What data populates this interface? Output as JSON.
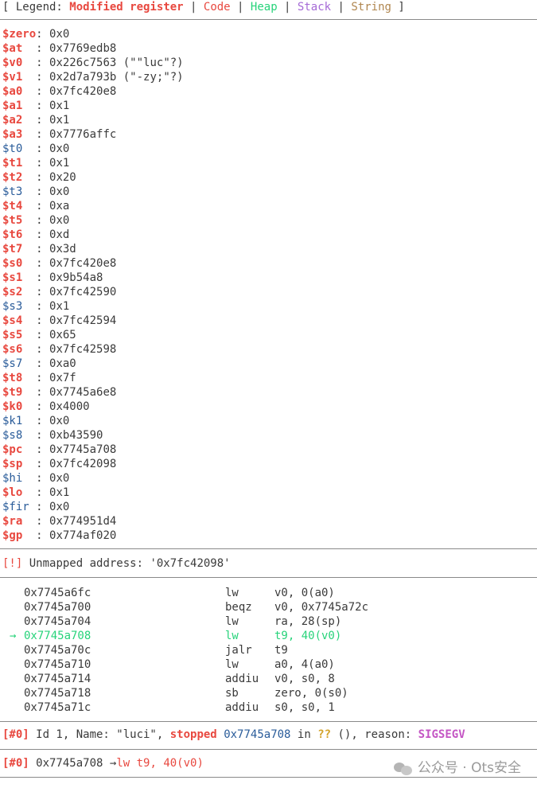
{
  "legend": {
    "prefix": "[ Legend: ",
    "modified": "Modified register",
    "code": "Code",
    "heap": "Heap",
    "stack": "Stack",
    "string": "String",
    "divider": " | ",
    "suffix": " ]"
  },
  "registers": [
    {
      "name": "$zero",
      "pad": "",
      "value": "0x0",
      "modified": true
    },
    {
      "name": "$at",
      "pad": "  ",
      "value": "0x7769edb8",
      "modified": true
    },
    {
      "name": "$v0",
      "pad": "  ",
      "value": "0x226c7563",
      "extra": "(\"\"luc\"?)",
      "modified": true
    },
    {
      "name": "$v1",
      "pad": "  ",
      "value": "0x2d7a793b",
      "extra": "(\"-zy;\"?)",
      "modified": true
    },
    {
      "name": "$a0",
      "pad": "  ",
      "value": "0x7fc420e8",
      "modified": true
    },
    {
      "name": "$a1",
      "pad": "  ",
      "value": "0x1",
      "modified": true
    },
    {
      "name": "$a2",
      "pad": "  ",
      "value": "0x1",
      "modified": true
    },
    {
      "name": "$a3",
      "pad": "  ",
      "value": "0x7776affc",
      "modified": true
    },
    {
      "name": "$t0",
      "pad": "  ",
      "value": "0x0",
      "modified": false
    },
    {
      "name": "$t1",
      "pad": "  ",
      "value": "0x1",
      "modified": true
    },
    {
      "name": "$t2",
      "pad": "  ",
      "value": "0x20",
      "modified": true
    },
    {
      "name": "$t3",
      "pad": "  ",
      "value": "0x0",
      "modified": false
    },
    {
      "name": "$t4",
      "pad": "  ",
      "value": "0xa",
      "modified": true
    },
    {
      "name": "$t5",
      "pad": "  ",
      "value": "0x0",
      "modified": true
    },
    {
      "name": "$t6",
      "pad": "  ",
      "value": "0xd",
      "modified": true
    },
    {
      "name": "$t7",
      "pad": "  ",
      "value": "0x3d",
      "modified": true
    },
    {
      "name": "$s0",
      "pad": "  ",
      "value": "0x7fc420e8",
      "modified": true
    },
    {
      "name": "$s1",
      "pad": "  ",
      "value": "0x9b54a8",
      "modified": true
    },
    {
      "name": "$s2",
      "pad": "  ",
      "value": "0x7fc42590",
      "modified": true
    },
    {
      "name": "$s3",
      "pad": "  ",
      "value": "0x1",
      "modified": false
    },
    {
      "name": "$s4",
      "pad": "  ",
      "value": "0x7fc42594",
      "modified": true
    },
    {
      "name": "$s5",
      "pad": "  ",
      "value": "0x65",
      "modified": true
    },
    {
      "name": "$s6",
      "pad": "  ",
      "value": "0x7fc42598",
      "modified": true
    },
    {
      "name": "$s7",
      "pad": "  ",
      "value": "0xa0",
      "modified": false
    },
    {
      "name": "$t8",
      "pad": "  ",
      "value": "0x7f",
      "modified": true
    },
    {
      "name": "$t9",
      "pad": "  ",
      "value": "0x7745a6e8",
      "modified": true
    },
    {
      "name": "$k0",
      "pad": "  ",
      "value": "0x4000",
      "modified": true
    },
    {
      "name": "$k1",
      "pad": "  ",
      "value": "0x0",
      "modified": false
    },
    {
      "name": "$s8",
      "pad": "  ",
      "value": "0xb43590",
      "modified": false
    },
    {
      "name": "$pc",
      "pad": "  ",
      "value": "0x7745a708",
      "modified": true
    },
    {
      "name": "$sp",
      "pad": "  ",
      "value": "0x7fc42098",
      "modified": true
    },
    {
      "name": "$hi",
      "pad": "  ",
      "value": "0x0",
      "modified": false
    },
    {
      "name": "$lo",
      "pad": "  ",
      "value": "0x1",
      "modified": true
    },
    {
      "name": "$fir",
      "pad": " ",
      "value": "0x0",
      "modified": false
    },
    {
      "name": "$ra",
      "pad": "  ",
      "value": "0x774951d4",
      "modified": true
    },
    {
      "name": "$gp",
      "pad": "  ",
      "value": "0x774af020",
      "modified": true
    }
  ],
  "warning": {
    "tag": "[!]",
    "text": " Unmapped address: '0x7fc42098'"
  },
  "disassembly": [
    {
      "addr": "0x7745a6fc",
      "op": "lw",
      "args": "v0, 0(a0)",
      "current": false
    },
    {
      "addr": "0x7745a700",
      "op": "beqz",
      "args": "v0, 0x7745a72c",
      "current": false
    },
    {
      "addr": "0x7745a704",
      "op": "lw",
      "args": "ra, 28(sp)",
      "current": false
    },
    {
      "addr": "0x7745a708",
      "op": "lw",
      "args": "t9, 40(v0)",
      "current": true,
      "arrow": "→"
    },
    {
      "addr": "0x7745a70c",
      "op": "jalr",
      "args": "t9",
      "current": false
    },
    {
      "addr": "0x7745a710",
      "op": "lw",
      "args": "a0, 4(a0)",
      "current": false
    },
    {
      "addr": "0x7745a714",
      "op": "addiu",
      "args": "v0, s0, 8",
      "current": false
    },
    {
      "addr": "0x7745a718",
      "op": "sb",
      "args": "zero, 0(s0)",
      "current": false
    },
    {
      "addr": "0x7745a71c",
      "op": "addiu",
      "args": "s0, s0, 1",
      "current": false
    }
  ],
  "thread": {
    "tag": "[#0]",
    "id_text": " Id 1, Name: \"luci\", ",
    "status": "stopped",
    "space": " ",
    "addr": "0x7745a708",
    "in": " in ",
    "func": "??",
    "rest": " (), reason: ",
    "reason": "SIGSEGV"
  },
  "trace": {
    "tag": "[#0]",
    "addr": " 0x7745a708 ",
    "arrow": "→",
    "instr": "lw t9, 40(v0)"
  },
  "watermark": {
    "text": "公众号 · Ots安全"
  }
}
